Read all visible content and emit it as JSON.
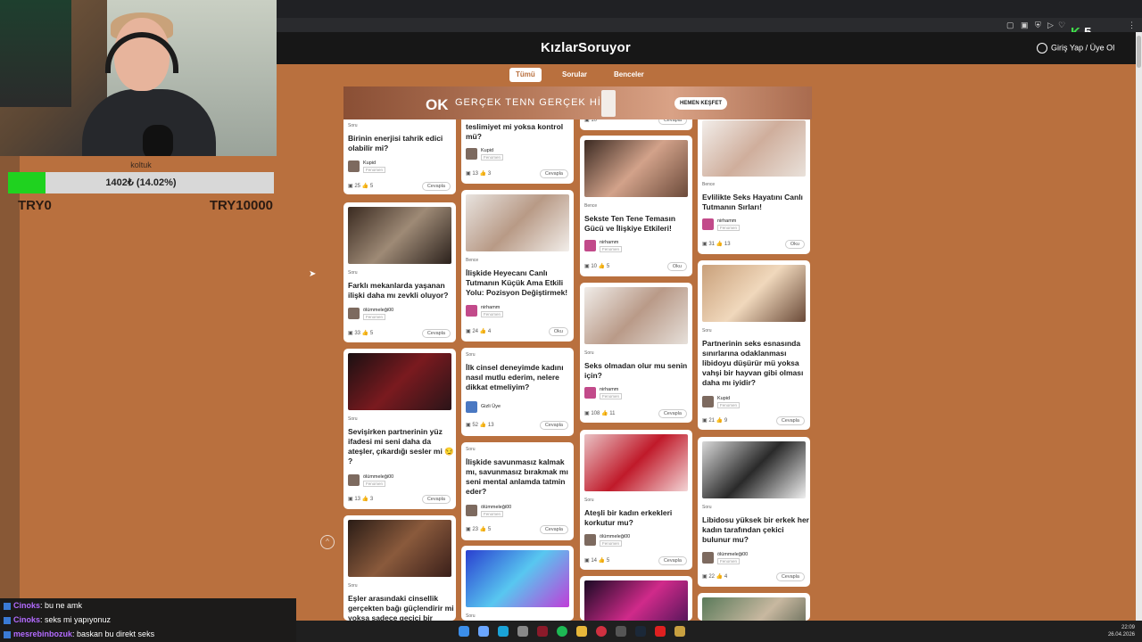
{
  "stream": {
    "goal": {
      "title": "koltuk",
      "progress_text": "1402₺ (14.02%)",
      "progress_fraction": 0.1402,
      "min_label": "TRY0",
      "max_label": "TRY10000"
    },
    "chat": [
      {
        "user": "Cinoks",
        "user_color": "#b36bff",
        "message": ": bu ne amk"
      },
      {
        "user": "Cinoks",
        "user_color": "#b36bff",
        "message": ": seks mi yapıyonuz"
      },
      {
        "user": "mesrebinbozuk",
        "user_color": "#b36bff",
        "message": ": baskan bu direkt seks"
      }
    ]
  },
  "browser": {
    "k_badge": "5"
  },
  "site": {
    "logo": "KızlarSoruyor",
    "login_label": "Giriş Yap / Üye Ol",
    "tabs": [
      {
        "label": "Tümü",
        "active": true
      },
      {
        "label": "Sorular",
        "active": false
      },
      {
        "label": "Benceler",
        "active": false
      }
    ],
    "banner": {
      "brand": "OK",
      "slogan": "GERÇEK TENN GERÇEK HİS",
      "cta": "HEMEN KEŞFET"
    }
  },
  "cards": [
    {
      "type": "Soru",
      "title": "Birinin enerjisi tahrik edici olabilir mi?",
      "author": "Kupid",
      "role": "Fenomen",
      "comments": "25",
      "likes": "5",
      "action": "Cevapla"
    },
    {
      "type": "Soru",
      "title": "Farklı mekanlarda yaşanan ilişki daha mı zevkli oluyor?",
      "author": "ölümmeleği00",
      "role": "Fenomen",
      "comments": "33",
      "likes": "5",
      "action": "Cevapla"
    },
    {
      "type": "Soru",
      "title": "Sevişirken partnerinin yüz ifadesi mi seni daha da ateşler, çıkardığı sesler mi 😏 ?",
      "author": "ölümmeleği00",
      "role": "Fenomen",
      "comments": "13",
      "likes": "3",
      "action": "Cevapla"
    },
    {
      "type": "Soru",
      "title": "Eşler arasındaki cinsellik gerçekten bağı güçlendirir mi yoksa sadece geçici bir"
    },
    {
      "type": "",
      "title": "teslimiyet mi yoksa kontrol mü?",
      "author": "Kupid",
      "role": "Fenomen",
      "comments": "13",
      "likes": "3",
      "action": "Cevapla"
    },
    {
      "type": "Bence",
      "title": "İlişkide Heyecanı Canlı Tutmanın Küçük Ama Etkili Yolu: Pozisyon Değiştirmek!",
      "author": "nirhamm",
      "role": "Fenomen",
      "comments": "24",
      "likes": "4",
      "action": "Oku"
    },
    {
      "type": "Soru",
      "title": "İlk cinsel deneyimde kadını nasıl mutlu ederim, nelere dikkat etmeliyim?",
      "author": "Gizli Üye",
      "role": "",
      "comments": "52",
      "likes": "13",
      "action": "Cevapla"
    },
    {
      "type": "Soru",
      "title": "İlişkide savunmasız kalmak mı, savunmasız bırakmak mı seni mental anlamda tatmin eder?",
      "author": "ölümmeleği00",
      "role": "Fenomen",
      "comments": "23",
      "likes": "5",
      "action": "Cevapla"
    },
    {
      "type": "Soru",
      "title": ""
    },
    {
      "type": "Bence",
      "title": "Sekste Ten Tene Temasın Gücü ve İlişkiye Etkileri!",
      "author": "nirhamm",
      "role": "Fenomen",
      "comments": "10",
      "likes": "5",
      "action": "Oku"
    },
    {
      "type": "Soru",
      "title": "Seks olmadan olur mu senin için?",
      "author": "nirhamm",
      "role": "Fenomen",
      "comments": "108",
      "likes": "11",
      "action": "Cevapla"
    },
    {
      "type": "Soru",
      "title": "Ateşli bir kadın erkekleri korkutur mu?",
      "author": "ölümmeleği00",
      "role": "Fenomen",
      "comments": "14",
      "likes": "5",
      "action": "Cevapla"
    },
    {
      "type": "Bence",
      "title": "Evlilikte Seks Hayatını Canlı Tutmanın Sırları!",
      "author": "nirhamm",
      "role": "Fenomen",
      "comments": "31",
      "likes": "13",
      "action": "Oku"
    },
    {
      "type": "Soru",
      "title": "Partnerinin seks esnasında sınırlarına odaklanması libidoyu düşürür mü yoksa vahşi bir hayvan gibi olması daha mı iyidir?",
      "author": "Kupid",
      "role": "Fenomen",
      "comments": "21",
      "likes": "9",
      "action": "Cevapla"
    },
    {
      "type": "Soru",
      "title": "Libidosu yüksek bir erkek her kadın tarafından çekici bulunur mu?",
      "author": "ölümmeleği00",
      "role": "Fenomen",
      "comments": "22",
      "likes": "4",
      "action": "Cevapla"
    }
  ],
  "card_partial_top": [
    {
      "comments": "10",
      "action": "Cevapla"
    }
  ],
  "taskbar": {
    "time": "22:09",
    "date": "26.04.2026"
  },
  "colors": {
    "page_bg": "#b9703e",
    "site_header": "#171717",
    "goal_fill": "#1fd21f",
    "k_green": "#40e04a"
  }
}
